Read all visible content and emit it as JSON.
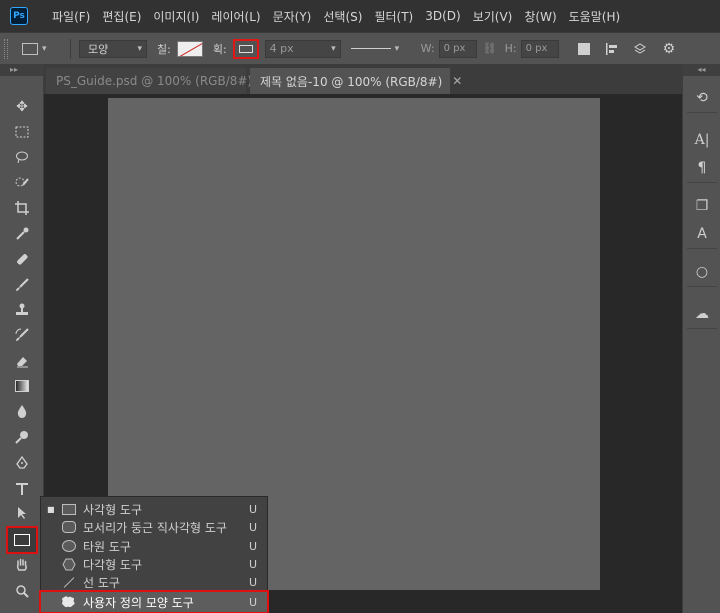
{
  "app": {
    "logo": "Ps"
  },
  "menu": [
    "파일(F)",
    "편집(E)",
    "이미지(I)",
    "레이어(L)",
    "문자(Y)",
    "선택(S)",
    "필터(T)",
    "3D(D)",
    "보기(V)",
    "창(W)",
    "도움말(H)"
  ],
  "options": {
    "mode": "모양",
    "fill_label": "칠:",
    "stroke_label": "획:",
    "stroke_width": "4 px",
    "w_label": "W:",
    "w_value": "0 px",
    "h_label": "H:",
    "h_value": "0 px"
  },
  "tabs": [
    {
      "label": "PS_Guide.psd @ 100% (RGB/8#)",
      "active": false
    },
    {
      "label": "제목 없음-10 @ 100% (RGB/8#)",
      "active": true
    }
  ],
  "flyout": [
    {
      "label": "사각형 도구",
      "shortcut": "U",
      "icon": "rectangle-icon",
      "current": true
    },
    {
      "label": "모서리가 둥근 직사각형 도구",
      "shortcut": "U",
      "icon": "rounded-rectangle-icon"
    },
    {
      "label": "타원 도구",
      "shortcut": "U",
      "icon": "ellipse-icon"
    },
    {
      "label": "다각형 도구",
      "shortcut": "U",
      "icon": "polygon-icon"
    },
    {
      "label": "선 도구",
      "shortcut": "U",
      "icon": "line-icon"
    },
    {
      "label": "사용자 정의 모양 도구",
      "shortcut": "U",
      "icon": "custom-shape-icon",
      "highlighted": true
    }
  ],
  "colors": {
    "highlight_border": "#e01010",
    "canvas": "#646464",
    "workspace": "#282828"
  }
}
